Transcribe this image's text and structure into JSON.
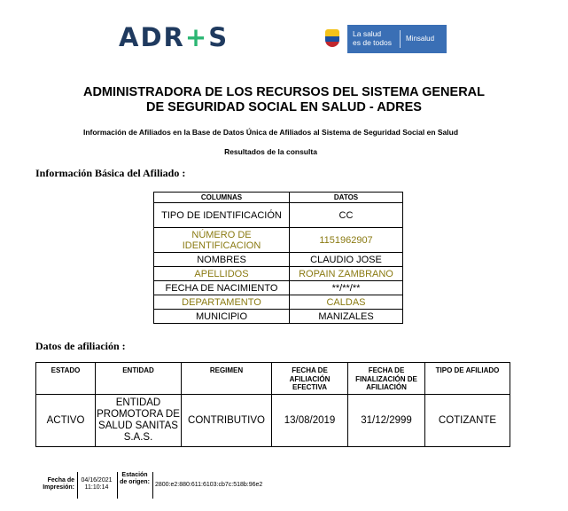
{
  "header": {
    "brand_logo": "ADRES",
    "minsalud_slogan_line1": "La salud",
    "minsalud_slogan_line2": "es de todos",
    "minsalud_label": "Minsalud"
  },
  "title_line1": "ADMINISTRADORA DE LOS RECURSOS DEL SISTEMA GENERAL",
  "title_line2": "DE SEGURIDAD SOCIAL EN SALUD - ADRES",
  "subtitle": "Información de Afiliados en la Base de Datos Única de Afiliados al Sistema de Seguridad Social en Salud",
  "results_label": "Resultados de la consulta",
  "basic_info": {
    "heading": "Información Básica del Afiliado :",
    "col_headers": [
      "COLUMNAS",
      "DATOS"
    ],
    "rows": [
      {
        "label": "TIPO DE IDENTIFICACIÓN",
        "value": "CC"
      },
      {
        "label": "NÚMERO DE IDENTIFICACION",
        "value": "1151962907"
      },
      {
        "label": "NOMBRES",
        "value": "CLAUDIO JOSE"
      },
      {
        "label": "APELLIDOS",
        "value": "ROPAIN ZAMBRANO"
      },
      {
        "label": "FECHA DE NACIMIENTO",
        "value": "**/**/**"
      },
      {
        "label": "DEPARTAMENTO",
        "value": "CALDAS"
      },
      {
        "label": "MUNICIPIO",
        "value": "MANIZALES"
      }
    ]
  },
  "affiliation": {
    "heading": "Datos de afiliación :",
    "headers": [
      "ESTADO",
      "ENTIDAD",
      "REGIMEN",
      "FECHA DE AFILIACIÓN EFECTIVA",
      "FECHA DE FINALIZACIÓN DE AFILIACIÓN",
      "TIPO DE AFILIADO"
    ],
    "row": [
      "ACTIVO",
      "ENTIDAD PROMOTORA DE SALUD SANITAS S.A.S.",
      "CONTRIBUTIVO",
      "13/08/2019",
      "31/12/2999",
      "COTIZANTE"
    ]
  },
  "footer": {
    "print_date_label": "Fecha de Impresión:",
    "print_date_value": "04/16/2021 11:10:14",
    "station_label": "Estación de origen:",
    "station_value": "2800:e2:880:611:6103:cb7c:518b:96e2"
  }
}
